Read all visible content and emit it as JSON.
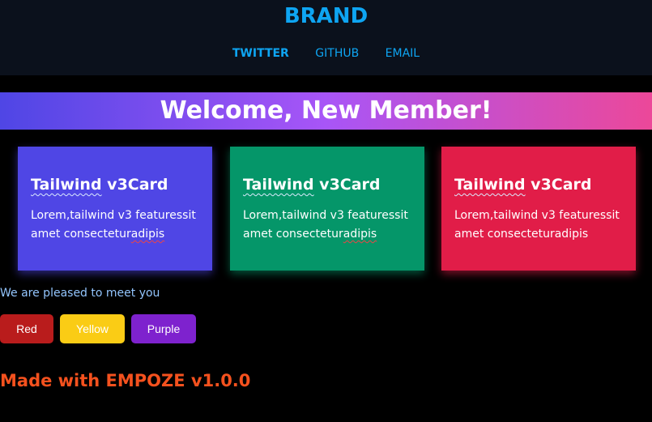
{
  "header": {
    "brand": "BRAND",
    "nav": [
      {
        "label": "TWITTER",
        "active": true
      },
      {
        "label": "GITHUB",
        "active": false
      },
      {
        "label": "EMAIL",
        "active": false
      }
    ]
  },
  "banner": {
    "title": "Welcome, New Member!"
  },
  "cards": [
    {
      "title_a": "Tailwind",
      "title_b": " v3Card",
      "text_a": "Lorem,tailwind v3 featuressit amet consectetur",
      "text_b": "adipis",
      "color": "#4f46e5"
    },
    {
      "title_a": "Tailwind",
      "title_b": " v3Card",
      "text_a": "Lorem,tailwind v3 featuressit amet consectetur",
      "text_b": "adipis",
      "color": "#059669"
    },
    {
      "title_a": "Tailwind",
      "title_b": " v3Card",
      "text_a": "Lorem,tailwind v3 featuressit amet consecteturadipis",
      "text_b": "",
      "color": "#e11d48"
    }
  ],
  "greeting": "We are pleased to meet you",
  "buttons": [
    {
      "label": "Red",
      "color": "#b91c1c"
    },
    {
      "label": "Yellow",
      "color": "#facc15"
    },
    {
      "label": "Purple",
      "color": "#7e22ce"
    }
  ],
  "footer": "Made with EMPOZE v1.0.0",
  "colors": {
    "accent": "#0ea5f2",
    "header_bg": "#0b111c",
    "page_bg": "#000000",
    "footer_text": "#f4511e",
    "greeting_text": "#93c5fd"
  }
}
